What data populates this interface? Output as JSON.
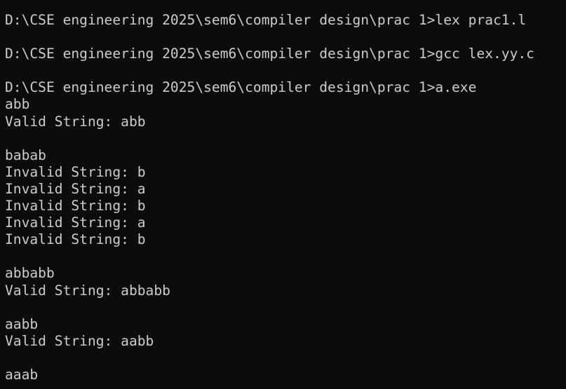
{
  "terminal": {
    "lines": [
      "D:\\CSE engineering 2025\\sem6\\compiler design\\prac 1>lex prac1.l",
      "",
      "D:\\CSE engineering 2025\\sem6\\compiler design\\prac 1>gcc lex.yy.c",
      "",
      "D:\\CSE engineering 2025\\sem6\\compiler design\\prac 1>a.exe",
      "abb",
      "Valid String: abb",
      "",
      "babab",
      "Invalid String: b",
      "Invalid String: a",
      "Invalid String: b",
      "Invalid String: a",
      "Invalid String: b",
      "",
      "abbabb",
      "Valid String: abbabb",
      "",
      "aabb",
      "Valid String: aabb",
      "",
      "aaab"
    ]
  },
  "colors": {
    "background": "#0c0c0c",
    "text": "#cccccc"
  }
}
